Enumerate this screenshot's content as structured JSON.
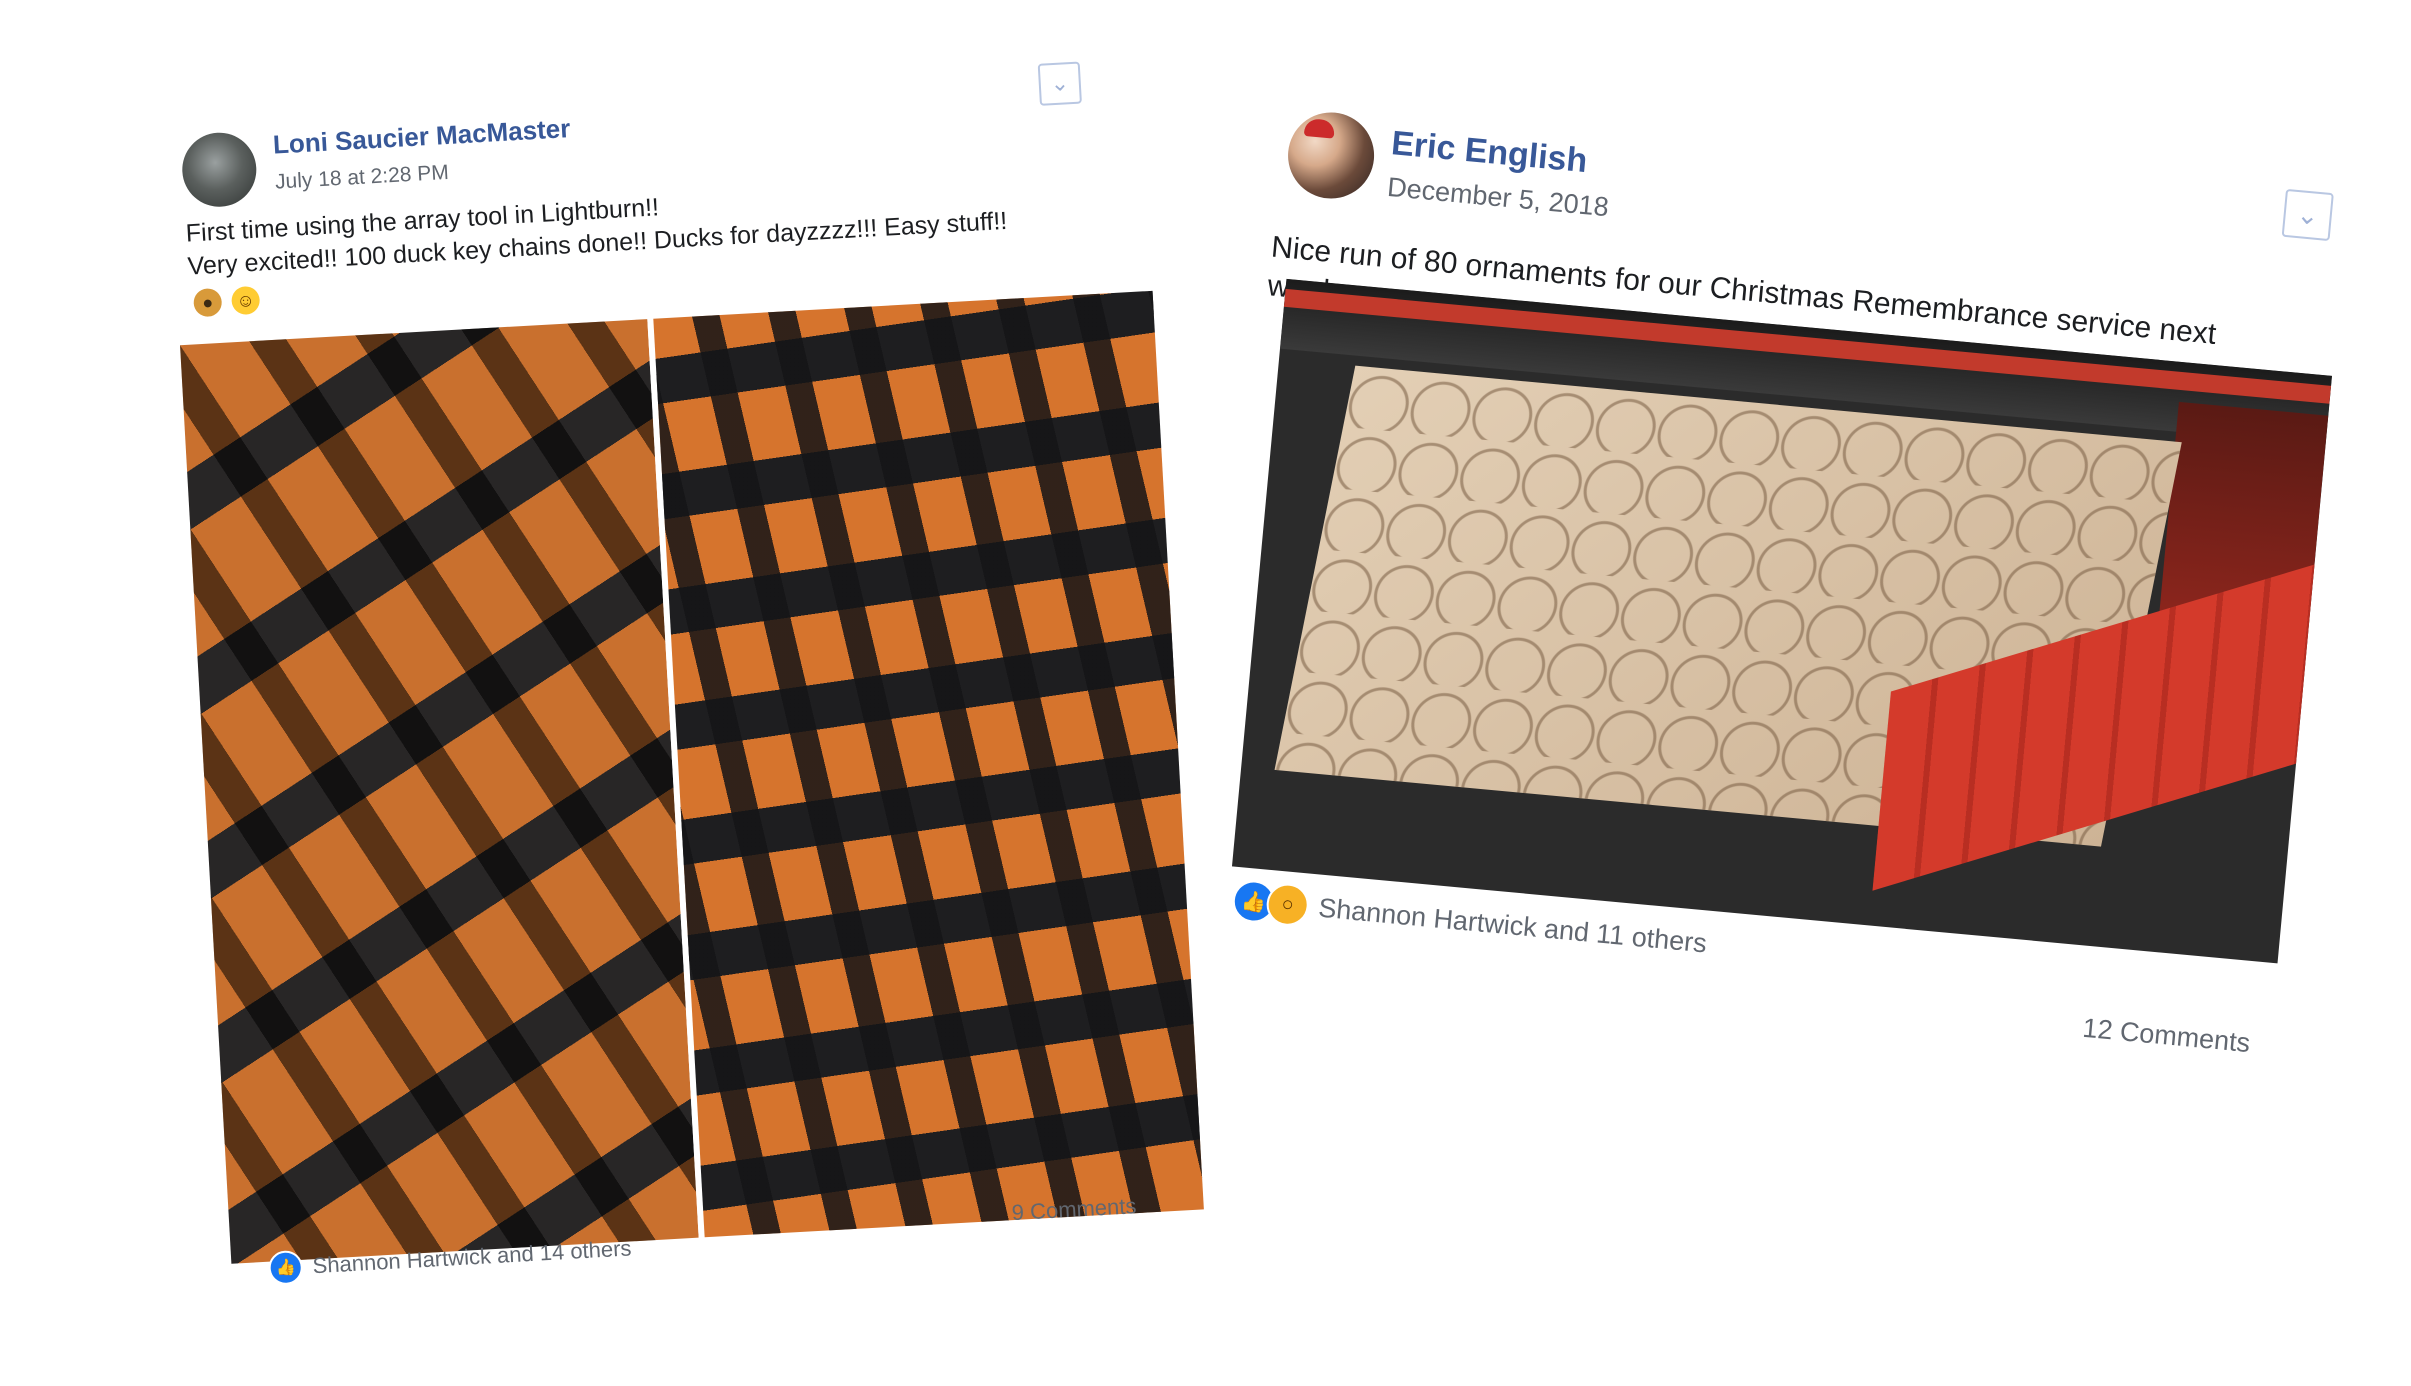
{
  "posts": [
    {
      "author": "Loni Saucier MacMaster",
      "timestamp": "July 18 at 2:28 PM",
      "text_line1": "First time using the array tool in Lightburn!!",
      "text_line2": "Very excited!! 100 duck key chains done!! Ducks for dayzzzz!!! Easy stuff!!",
      "emojis": [
        "duck-emoji",
        "winking-tongue-emoji"
      ],
      "reactions_text": "Shannon Hartwick and 14 others",
      "comments_text": "9 Comments"
    },
    {
      "author": "Eric English",
      "timestamp": "December 5, 2018",
      "text_line1": "Nice run of 80 ornaments for our Christmas Remembrance service next",
      "text_line2": "week.",
      "reactions_text": "Shannon Hartwick and 11 others",
      "comments_text": "12 Comments"
    }
  ],
  "icons": {
    "chevron": "chevron-down-icon",
    "like": "like-reaction-icon",
    "wow": "wow-reaction-icon"
  },
  "colors": {
    "author_link": "#385898",
    "meta_text": "#616770",
    "like_blue": "#1877f2",
    "wow_yellow": "#f7b125"
  }
}
